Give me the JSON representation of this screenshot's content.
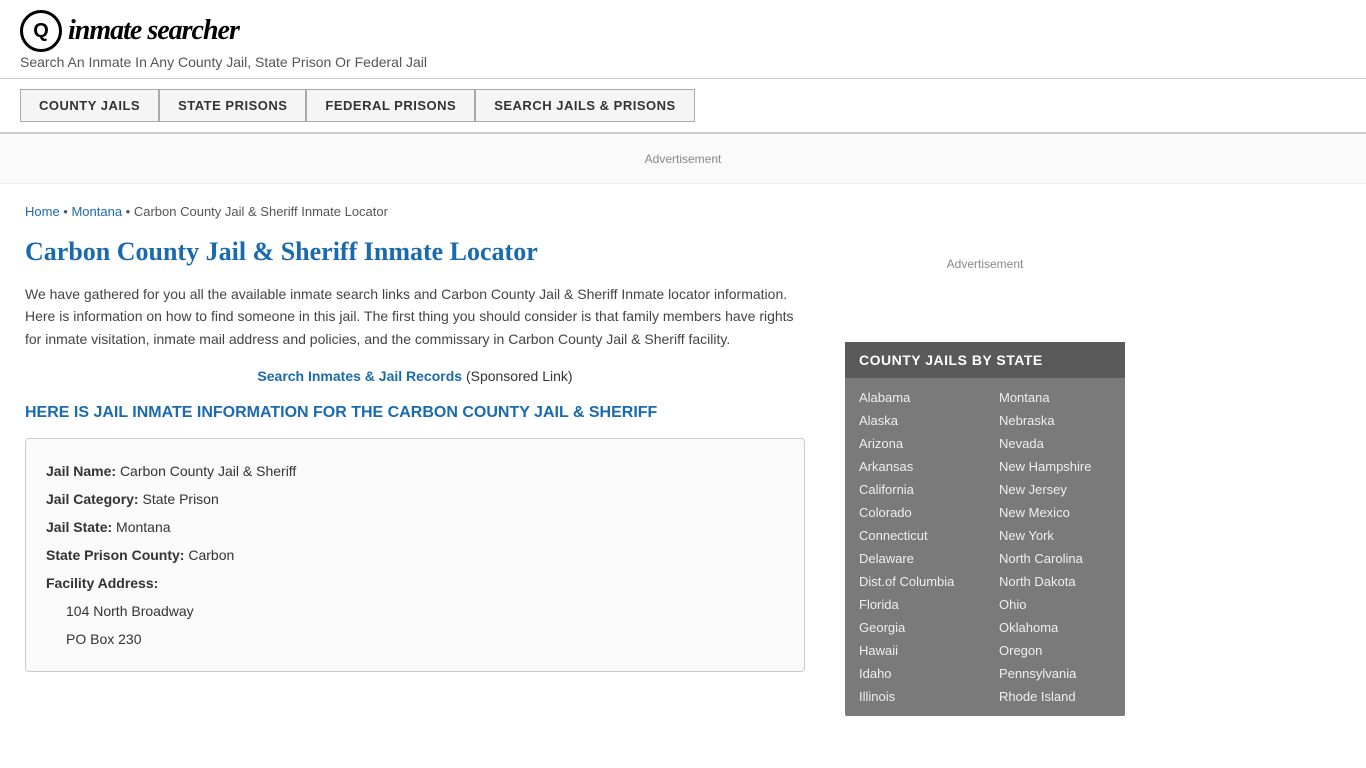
{
  "header": {
    "logo_icon": "Q",
    "logo_text": "inmate searcher",
    "tagline": "Search An Inmate In Any County Jail, State Prison Or Federal Jail"
  },
  "nav": {
    "buttons": [
      {
        "id": "county-jails",
        "label": "COUNTY JAILS"
      },
      {
        "id": "state-prisons",
        "label": "STATE PRISONS"
      },
      {
        "id": "federal-prisons",
        "label": "FEDERAL PRISONS"
      },
      {
        "id": "search-jails",
        "label": "SEARCH JAILS & PRISONS"
      }
    ]
  },
  "ad_bar": {
    "label": "Advertisement"
  },
  "breadcrumb": {
    "home_label": "Home",
    "separator1": " • ",
    "state_label": "Montana",
    "separator2": " • ",
    "current": "Carbon County Jail & Sheriff Inmate Locator"
  },
  "page_title": "Carbon County Jail & Sheriff Inmate Locator",
  "description": "We have gathered for you all the available inmate search links and Carbon County Jail & Sheriff Inmate locator information. Here is information on how to find someone in this jail. The first thing you should consider is that family members have rights for inmate visitation, inmate mail address and policies, and the commissary in Carbon County Jail & Sheriff facility.",
  "sponsored": {
    "link_text": "Search Inmates & Jail Records",
    "suffix": " (Sponsored Link)"
  },
  "info_heading": "HERE IS JAIL INMATE INFORMATION FOR THE CARBON COUNTY JAIL & SHERIFF",
  "jail_info": {
    "jail_name_label": "Jail Name:",
    "jail_name_value": "Carbon County Jail & Sheriff",
    "jail_category_label": "Jail Category:",
    "jail_category_value": "State Prison",
    "jail_state_label": "Jail State:",
    "jail_state_value": "Montana",
    "state_prison_county_label": "State Prison County:",
    "state_prison_county_value": "Carbon",
    "facility_address_label": "Facility Address:",
    "address_line1": "104 North Broadway",
    "address_line2": "PO Box 230"
  },
  "sidebar": {
    "ad_label": "Advertisement",
    "jails_by_state_title": "COUNTY JAILS BY STATE",
    "states_left": [
      "Alabama",
      "Alaska",
      "Arizona",
      "Arkansas",
      "California",
      "Colorado",
      "Connecticut",
      "Delaware",
      "Dist.of Columbia",
      "Florida",
      "Georgia",
      "Hawaii",
      "Idaho",
      "Illinois"
    ],
    "states_right": [
      "Montana",
      "Nebraska",
      "Nevada",
      "New Hampshire",
      "New Jersey",
      "New Mexico",
      "New York",
      "North Carolina",
      "North Dakota",
      "Ohio",
      "Oklahoma",
      "Oregon",
      "Pennsylvania",
      "Rhode Island"
    ]
  }
}
